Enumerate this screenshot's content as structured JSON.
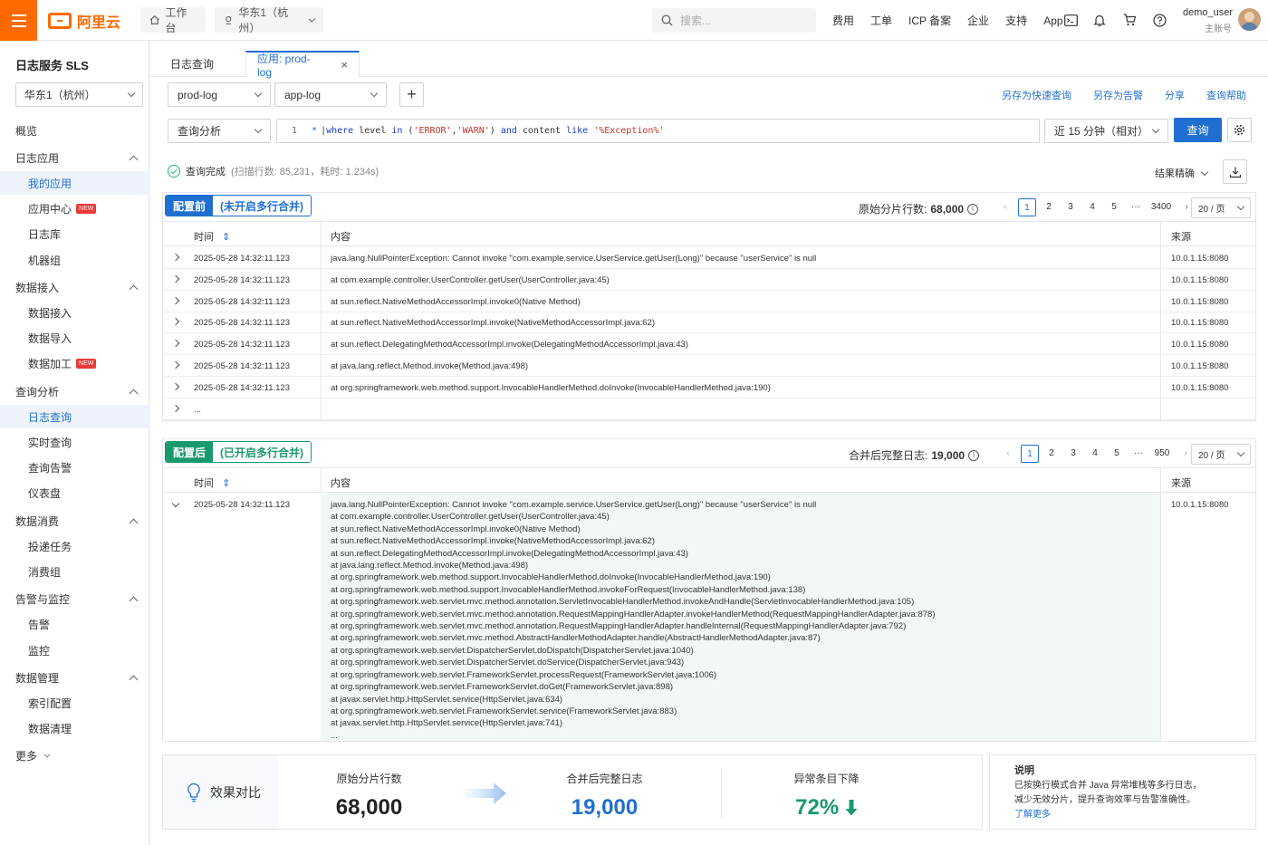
{
  "topbar": {
    "brand": "阿里云",
    "workbench": "工作台",
    "region": "华东1（杭州）",
    "search_placeholder": "搜索...",
    "links": [
      "费用",
      "工单",
      "ICP 备案",
      "企业",
      "支持",
      "App"
    ],
    "user_name": "demo_user",
    "user_role": "主账号"
  },
  "sidebar": {
    "title": "日志服务 SLS",
    "region": "华东1（杭州）",
    "items": [
      {
        "label": "概览",
        "level": 0
      },
      {
        "label": "日志应用",
        "level": 0,
        "group": true
      },
      {
        "label": "我的应用",
        "level": 1,
        "active": true
      },
      {
        "label": "应用中心",
        "level": 1,
        "badge": "NEW"
      },
      {
        "label": "日志库",
        "level": 1
      },
      {
        "label": "机器组",
        "level": 1
      },
      {
        "label": "数据接入",
        "level": 0,
        "group": true
      },
      {
        "label": "数据接入",
        "level": 1
      },
      {
        "label": "数据导入",
        "level": 1
      },
      {
        "label": "数据加工",
        "level": 1,
        "badge": "NEW"
      },
      {
        "label": "查询分析",
        "level": 0,
        "group": true
      },
      {
        "label": "日志查询",
        "level": 1,
        "active": true
      },
      {
        "label": "实时查询",
        "level": 1
      },
      {
        "label": "查询告警",
        "level": 1
      },
      {
        "label": "仪表盘",
        "level": 1
      },
      {
        "label": "数据消费",
        "level": 0,
        "group": true
      },
      {
        "label": "投递任务",
        "level": 1
      },
      {
        "label": "消费组",
        "level": 1
      },
      {
        "label": "告警与监控",
        "level": 0,
        "group": true
      },
      {
        "label": "告警",
        "level": 1
      },
      {
        "label": "监控",
        "level": 1
      },
      {
        "label": "数据管理",
        "level": 0,
        "group": true
      },
      {
        "label": "索引配置",
        "level": 1
      },
      {
        "label": "数据清理",
        "level": 1
      },
      {
        "label": "更多",
        "level": 0,
        "more": true
      }
    ]
  },
  "tabs": {
    "query": "日志查询",
    "app": "应用: prod-log"
  },
  "toolbar": {
    "project": "prod-log",
    "logstore": "app-log",
    "actions": [
      "另存为快速查询",
      "另存为告警",
      "分享",
      "查询帮助"
    ],
    "mode": "查询分析",
    "line_no": "1",
    "query": {
      "t1": "| ",
      "kw1": "where",
      "t2": " level ",
      "kw2": "in",
      "t3": " (",
      "s1": "'ERROR'",
      "t4": ",",
      "s2": "'WARN'",
      "t5": ") ",
      "kw3": "and",
      "t6": " content ",
      "kw4": "like",
      "t7": " ",
      "s3": "'%Exception%'"
    },
    "time_range": "近 15 分钟（相对）",
    "run": "查询"
  },
  "status": {
    "text": "查询完成",
    "meta": "(扫描行数: 85,231，耗时: 1.234s)",
    "precision": "结果精确"
  },
  "before": {
    "badge_a": "配置前",
    "badge_b": "(未开启多行合并)",
    "count_label": "原始分片行数:",
    "count": "68,000",
    "pages": [
      "1",
      "2",
      "3",
      "4",
      "5",
      "···",
      "3400"
    ],
    "page_size": "20 / 页",
    "col_time": "时间",
    "col_content": "内容",
    "col_source": "来源",
    "rows": [
      {
        "time": "2025-05-28 14:32:11.123",
        "content": "java.lang.NullPointerException: Cannot invoke \"com.example.service.UserService.getUser(Long)\" because \"userService\" is null",
        "source": "10.0.1.15:8080"
      },
      {
        "time": "2025-05-28 14:32:11.123",
        "content": "at com.example.controller.UserController.getUser(UserController.java:45)",
        "source": "10.0.1.15:8080"
      },
      {
        "time": "2025-05-28 14:32:11.123",
        "content": "at sun.reflect.NativeMethodAccessorImpl.invoke0(Native Method)",
        "source": "10.0.1.15:8080"
      },
      {
        "time": "2025-05-28 14:32:11.123",
        "content": "at sun.reflect.NativeMethodAccessorImpl.invoke(NativeMethodAccessorImpl.java:62)",
        "source": "10.0.1.15:8080"
      },
      {
        "time": "2025-05-28 14:32:11.123",
        "content": "at sun.reflect.DelegatingMethodAccessorImpl.invoke(DelegatingMethodAccessorImpl.java:43)",
        "source": "10.0.1.15:8080"
      },
      {
        "time": "2025-05-28 14:32:11.123",
        "content": "at java.lang.reflect.Method.invoke(Method.java:498)",
        "source": "10.0.1.15:8080"
      },
      {
        "time": "2025-05-28 14:32:11.123",
        "content": "at org.springframework.web.method.support.InvocableHandlerMethod.doInvoke(InvocableHandlerMethod.java:190)",
        "source": "10.0.1.15:8080"
      },
      {
        "time": "...",
        "content": "",
        "source": ""
      }
    ]
  },
  "after": {
    "badge_a": "配置后",
    "badge_b": "(已开启多行合并)",
    "count_label": "合并后完整日志:",
    "count": "19,000",
    "pages": [
      "1",
      "2",
      "3",
      "4",
      "5",
      "···",
      "950"
    ],
    "page_size": "20 / 页",
    "col_time": "时间",
    "col_content": "内容",
    "col_source": "来源",
    "time": "2025-05-28 14:32:11.123",
    "source": "10.0.1.15:8080",
    "lines": [
      "java.lang.NullPointerException: Cannot invoke \"com.example.service.UserService.getUser(Long)\" because \"userService\" is null",
      "at com.example.controller.UserController.getUser(UserController.java:45)",
      "at sun.reflect.NativeMethodAccessorImpl.invoke0(Native Method)",
      "at sun.reflect.NativeMethodAccessorImpl.invoke(NativeMethodAccessorImpl.java:62)",
      "at sun.reflect.DelegatingMethodAccessorImpl.invoke(DelegatingMethodAccessorImpl.java:43)",
      "at java.lang.reflect.Method.invoke(Method.java:498)",
      "at org.springframework.web.method.support.InvocableHandlerMethod.doInvoke(InvocableHandlerMethod.java:190)",
      "at org.springframework.web.method.support.InvocableHandlerMethod.invokeForRequest(InvocableHandlerMethod.java:138)",
      "at org.springframework.web.servlet.mvc.method.annotation.ServletInvocableHandlerMethod.invokeAndHandle(ServletInvocableHandlerMethod.java:105)",
      "at org.springframework.web.servlet.mvc.method.annotation.RequestMappingHandlerAdapter.invokeHandlerMethod(RequestMappingHandlerAdapter.java:878)",
      "at org.springframework.web.servlet.mvc.method.annotation.RequestMappingHandlerAdapter.handleInternal(RequestMappingHandlerAdapter.java:792)",
      "at org.springframework.web.servlet.mvc.method.AbstractHandlerMethodAdapter.handle(AbstractHandlerMethodAdapter.java:87)",
      "at org.springframework.web.servlet.DispatcherServlet.doDispatch(DispatcherServlet.java:1040)",
      "at org.springframework.web.servlet.DispatcherServlet.doService(DispatcherServlet.java:943)",
      "at org.springframework.web.servlet.FrameworkServlet.processRequest(FrameworkServlet.java:1006)",
      "at org.springframework.web.servlet.FrameworkServlet.doGet(FrameworkServlet.java:898)",
      "at javax.servlet.http.HttpServlet.service(HttpServlet.java:634)",
      "at org.springframework.web.servlet.FrameworkServlet.service(FrameworkServlet.java:883)",
      "at javax.servlet.http.HttpServlet.service(HttpServlet.java:741)",
      "..."
    ]
  },
  "compare": {
    "title": "效果对比",
    "raw_label": "原始分片行数",
    "raw_value": "68,000",
    "merged_label": "合并后完整日志",
    "merged_value": "19,000",
    "drop_label": "异常条目下降",
    "drop_value": "72%"
  },
  "note": {
    "title": "说明",
    "line1": "已按换行模式合并 Java 异常堆栈等多行日志，",
    "line2": "减少无效分片，提升查询效率与告警准确性。",
    "more": "了解更多"
  },
  "colors": {
    "accent": "#ff6a00",
    "primary": "#1f6fd1",
    "before": "#1f6fd1",
    "after": "#1a9a6c",
    "merged_bg": "#f2f9f4"
  }
}
